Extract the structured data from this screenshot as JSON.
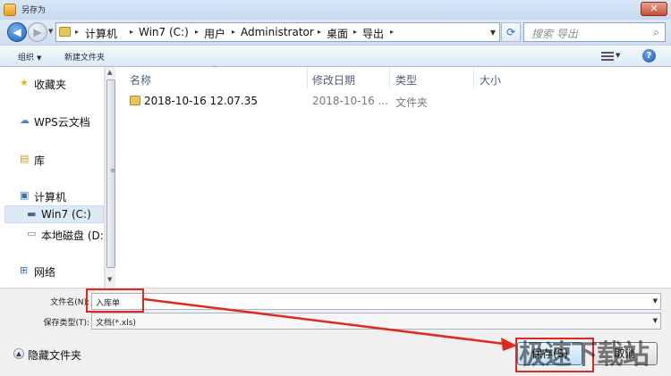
{
  "window": {
    "title": "另存为",
    "close_label": "✕"
  },
  "nav": {
    "breadcrumbs": [
      "计算机",
      "Win7 (C:)",
      "用户",
      "Administrator",
      "桌面",
      "导出"
    ],
    "search_placeholder": "搜索 导出"
  },
  "toolbar": {
    "organize": "组织",
    "new_folder": "新建文件夹"
  },
  "sidebar": {
    "items": [
      {
        "label": "收藏夹",
        "icon": "star-icon"
      },
      {
        "label": "WPS云文档",
        "icon": "cloud-icon"
      },
      {
        "label": "库",
        "icon": "library-icon"
      },
      {
        "label": "计算机",
        "icon": "computer-icon"
      },
      {
        "label": "Win7 (C:)",
        "icon": "drive-icon"
      },
      {
        "label": "本地磁盘 (D:",
        "icon": "disk-icon"
      },
      {
        "label": "网络",
        "icon": "network-icon"
      }
    ]
  },
  "filelist": {
    "columns": [
      "名称",
      "修改日期",
      "类型",
      "大小"
    ],
    "rows": [
      {
        "name": "2018-10-16 12.07.35",
        "date": "2018-10-16 ...",
        "type": "文件夹",
        "size": ""
      }
    ]
  },
  "form": {
    "filename_label": "文件名(N):",
    "filename_value": "入库单",
    "filetype_label": "保存类型(T):",
    "filetype_value": "文档(*.xls)"
  },
  "footer": {
    "hide_folders": "隐藏文件夹",
    "save_label": "保存(S)",
    "cancel_label": "取消"
  },
  "watermark": "极速下载站",
  "colors": {
    "highlight": "#e0291e",
    "selected_row": "#dde9f6",
    "accent": "#1f5fb4"
  }
}
